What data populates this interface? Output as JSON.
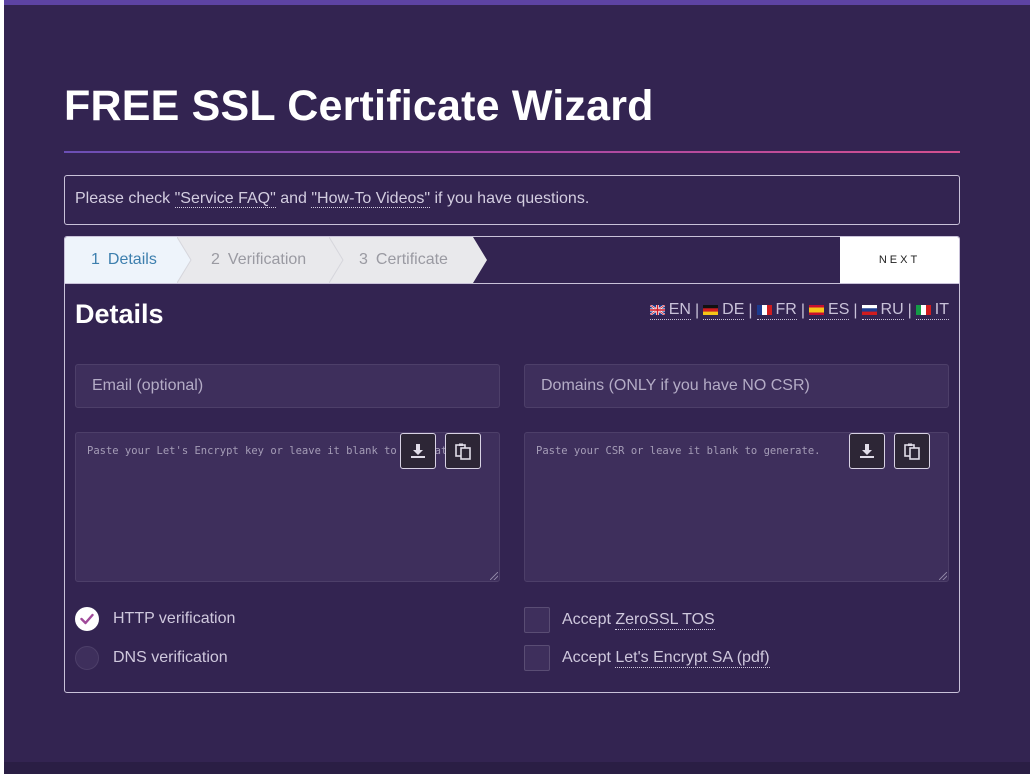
{
  "page": {
    "title": "FREE SSL Certificate Wizard"
  },
  "notice": {
    "prefix": "Please check ",
    "link_faq": "\"Service FAQ\"",
    "and": " and ",
    "link_videos": "\"How-To Videos\"",
    "suffix": " if you have questions."
  },
  "steps": [
    {
      "num": "1",
      "label": "Details",
      "active": true
    },
    {
      "num": "2",
      "label": "Verification",
      "active": false
    },
    {
      "num": "3",
      "label": "Certificate",
      "active": false
    }
  ],
  "next_button": "NEXT",
  "details": {
    "heading": "Details",
    "languages": [
      "EN",
      "DE",
      "FR",
      "ES",
      "RU",
      "IT"
    ],
    "email_placeholder": "Email (optional)",
    "domains_placeholder": "Domains (ONLY if you have NO CSR)",
    "key_placeholder": "Paste your Let's Encrypt key or leave it blank to generate.",
    "csr_placeholder": "Paste your CSR or leave it blank to generate."
  },
  "verification": {
    "http_label": "HTTP verification",
    "http_selected": true,
    "dns_label": "DNS verification",
    "dns_selected": false
  },
  "agreements": {
    "tos_prefix": "Accept ",
    "tos_link": "ZeroSSL TOS",
    "tos_checked": false,
    "le_prefix": "Accept ",
    "le_link": "Let's Encrypt SA (pdf)",
    "le_checked": false
  },
  "colors": {
    "background": "#332451",
    "accent_top": "#5d43a3",
    "active_step": "#3d7fae",
    "check_mark": "#a04a9a"
  }
}
